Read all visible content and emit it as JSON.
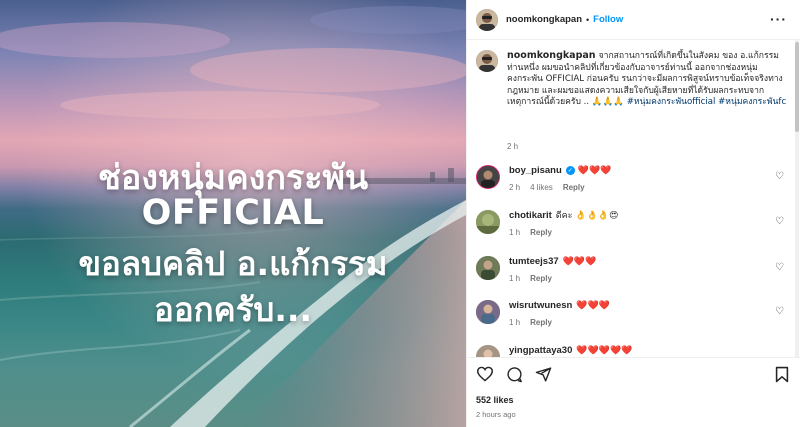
{
  "post": {
    "username": "noomkongkapan",
    "follow_label": "Follow",
    "dot": "•",
    "more_icon": "more-horizontal-icon",
    "image_overlay": {
      "line1": "ช่องหนุ่มคงกระพัน",
      "line2": "OFFICIAL",
      "line3": "ขอลบคลิป อ.แก้กรรม",
      "line4": "ออกครับ..."
    },
    "caption": {
      "username": "noomkongkapan",
      "text": "จากสถานการณ์ที่เกิดขึ้นในสังคม ของ อ.แก้กรรม ท่านหนึ่ง ผมขอนำคลิปที่เกี่ยวข้องกับอาจารย์ท่านนี้ ออกจากช่องหนุ่มคงกระพัน OFFICIAL ก่อนครับ รนกว่าจะมีผลการพิสูจน์ทราบข้อเท็จจริงทางกฎหมาย และผมขอแสดงความเสียใจกับผู้เสียหายที่ได้รับผลกระทบจากเหตุการณ์นี้ด้วยครับ .. 🙏🙏🙏 ",
      "hashtags": "#หนุ่มคงกระพันofficial #หนุ่มคงกระพันfc",
      "time": "2 h"
    },
    "comments": [
      {
        "username": "boy_pisanu",
        "verified": true,
        "text": "❤️❤️❤️",
        "time": "2 h",
        "likes": "4 likes",
        "reply": "Reply",
        "avatar_color": "#3a3a3a"
      },
      {
        "username": "chotikarit",
        "verified": false,
        "text": "ดีคะ 👌👌👌😍",
        "time": "1 h",
        "likes": "",
        "reply": "Reply",
        "avatar_color": "#7c8a5a"
      },
      {
        "username": "tumteejs37",
        "verified": false,
        "text": "❤️❤️❤️",
        "time": "1 h",
        "likes": "",
        "reply": "Reply",
        "avatar_color": "#5d6b4f"
      },
      {
        "username": "wisrutwunesn",
        "verified": false,
        "text": "❤️❤️❤️",
        "time": "1 h",
        "likes": "",
        "reply": "Reply",
        "avatar_color": "#6a5a7a"
      },
      {
        "username": "yingpattaya30",
        "verified": false,
        "text": "❤️❤️❤️❤️❤️",
        "time": "",
        "likes": "",
        "reply": "",
        "avatar_color": "#9a8a7a"
      }
    ],
    "likes_count": "552 likes",
    "posted": "2 hours ago",
    "icons": {
      "like": "heart-icon",
      "comment": "comment-icon",
      "share": "share-icon",
      "save": "bookmark-icon"
    }
  }
}
